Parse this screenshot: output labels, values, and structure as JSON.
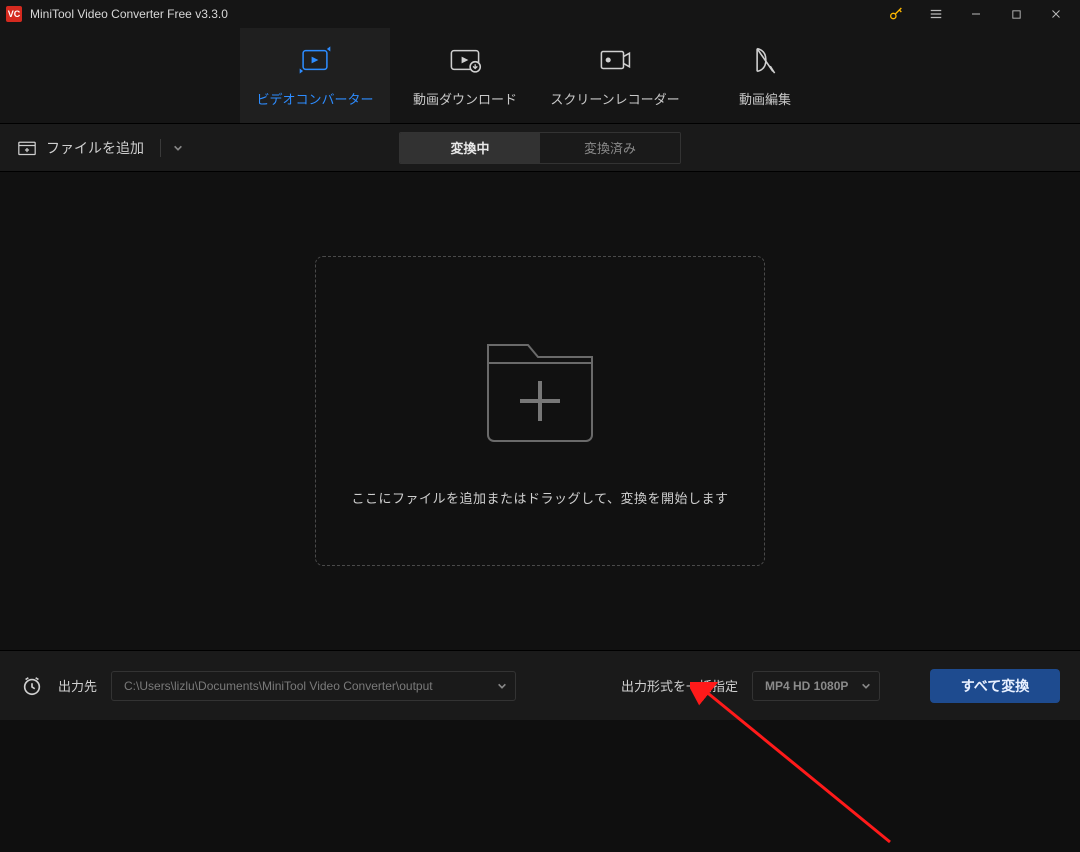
{
  "titlebar": {
    "app_title": "MiniTool Video Converter Free v3.3.0"
  },
  "nav": {
    "tabs": [
      {
        "label": "ビデオコンバーター"
      },
      {
        "label": "動画ダウンロード"
      },
      {
        "label": "スクリーンレコーダー"
      },
      {
        "label": "動画編集"
      }
    ]
  },
  "toolbar": {
    "add_file_label": "ファイルを追加",
    "seg_active": "変換中",
    "seg_inactive": "変換済み"
  },
  "dropzone": {
    "text": "ここにファイルを追加またはドラッグして、変換を開始します"
  },
  "footer": {
    "output_to_label": "出力先",
    "output_path": "C:\\Users\\lizlu\\Documents\\MiniTool Video Converter\\output",
    "format_label": "出力形式を一括指定",
    "format_value": "MP4 HD 1080P",
    "convert_all_label": "すべて変換"
  }
}
